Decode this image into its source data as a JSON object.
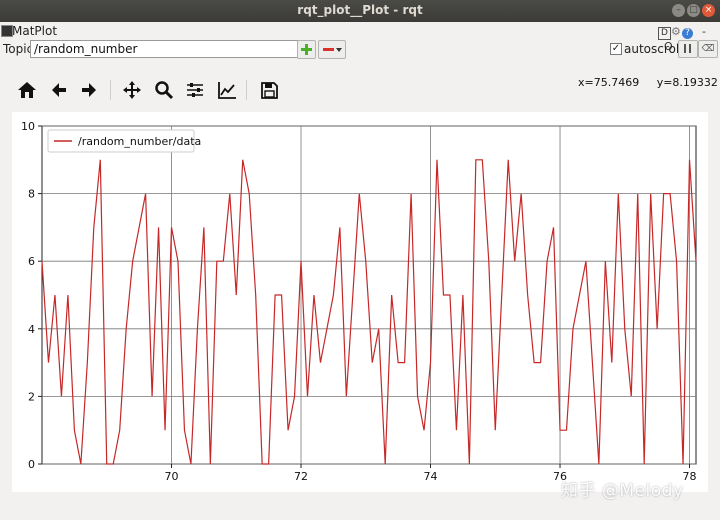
{
  "window": {
    "title": "rqt_plot__Plot - rqt",
    "minimize": "–",
    "maximize": "□",
    "close": "×"
  },
  "plugin": {
    "title": "MatPlot",
    "d_label": "D",
    "help_label": "?",
    "dash_label": "-",
    "o_label": "O"
  },
  "topic": {
    "label": "Topic",
    "value": "/random_number",
    "add_icon": "plus-icon",
    "remove_icon": "minus-dropdown-icon"
  },
  "autoscroll": {
    "checked": true,
    "check_mark": "✓",
    "label": "autoscroll",
    "clear_label": "⌫"
  },
  "toolbar": {
    "icons": [
      "home-icon",
      "back-arrow-icon",
      "forward-arrow-icon",
      "pan-icon",
      "zoom-icon",
      "configure-subplots-icon",
      "edit-axes-icon",
      "save-icon"
    ]
  },
  "cursor": {
    "x_text": "x=75.7469",
    "y_text": "y=8.19332"
  },
  "colors": {
    "series": "#c62828",
    "titlebar": "#3c3b37",
    "window_bg": "#f2f1f0"
  },
  "watermark": "知乎 @Melody",
  "chart_data": {
    "type": "line",
    "title": "",
    "xlabel": "",
    "ylabel": "",
    "xlim": [
      68.0,
      78.1
    ],
    "ylim": [
      0,
      10
    ],
    "xticks": [
      "70",
      "72",
      "74",
      "76",
      "78"
    ],
    "yticks": [
      "0",
      "2",
      "4",
      "6",
      "8",
      "10"
    ],
    "grid": true,
    "legend": "top-left",
    "series": [
      {
        "name": "/random_number/data",
        "x": [
          68.0,
          68.1,
          68.2,
          68.3,
          68.4,
          68.5,
          68.6,
          68.7,
          68.8,
          68.9,
          69.0,
          69.1,
          69.2,
          69.3,
          69.4,
          69.5,
          69.6,
          69.7,
          69.8,
          69.9,
          70.0,
          70.1,
          70.2,
          70.3,
          70.4,
          70.5,
          70.6,
          70.7,
          70.8,
          70.9,
          71.0,
          71.1,
          71.2,
          71.3,
          71.4,
          71.5,
          71.6,
          71.7,
          71.8,
          71.9,
          72.0,
          72.1,
          72.2,
          72.3,
          72.4,
          72.5,
          72.6,
          72.7,
          72.8,
          72.9,
          73.0,
          73.1,
          73.2,
          73.3,
          73.4,
          73.5,
          73.6,
          73.7,
          73.8,
          73.9,
          74.0,
          74.1,
          74.2,
          74.3,
          74.4,
          74.5,
          74.6,
          74.7,
          74.8,
          74.9,
          75.0,
          75.1,
          75.2,
          75.3,
          75.4,
          75.5,
          75.6,
          75.7,
          75.8,
          75.9,
          76.0,
          76.1,
          76.2,
          76.3,
          76.4,
          76.5,
          76.6,
          76.7,
          76.8,
          76.9,
          77.0,
          77.1,
          77.2,
          77.3,
          77.4,
          77.5,
          77.6,
          77.7,
          77.8,
          77.9,
          78.0,
          78.1
        ],
        "y": [
          6,
          3,
          5,
          2,
          5,
          1,
          0,
          3,
          7,
          9,
          0,
          0,
          1,
          4,
          6,
          7,
          8,
          2,
          7,
          1,
          7,
          6,
          1,
          0,
          4,
          7,
          0,
          6,
          6,
          8,
          5,
          9,
          8,
          5,
          0,
          0,
          5,
          5,
          1,
          2,
          6,
          2,
          5,
          3,
          4,
          5,
          7,
          2,
          5,
          8,
          6,
          3,
          4,
          0,
          5,
          3,
          3,
          8,
          2,
          1,
          3,
          9,
          5,
          5,
          1,
          5,
          0,
          9,
          9,
          6,
          1,
          5,
          9,
          6,
          8,
          5,
          3,
          3,
          6,
          7,
          1,
          1,
          4,
          5,
          6,
          3,
          0,
          6,
          3,
          8,
          4,
          2,
          8,
          0,
          8,
          4,
          8,
          8,
          6,
          0,
          9,
          6
        ]
      }
    ]
  }
}
